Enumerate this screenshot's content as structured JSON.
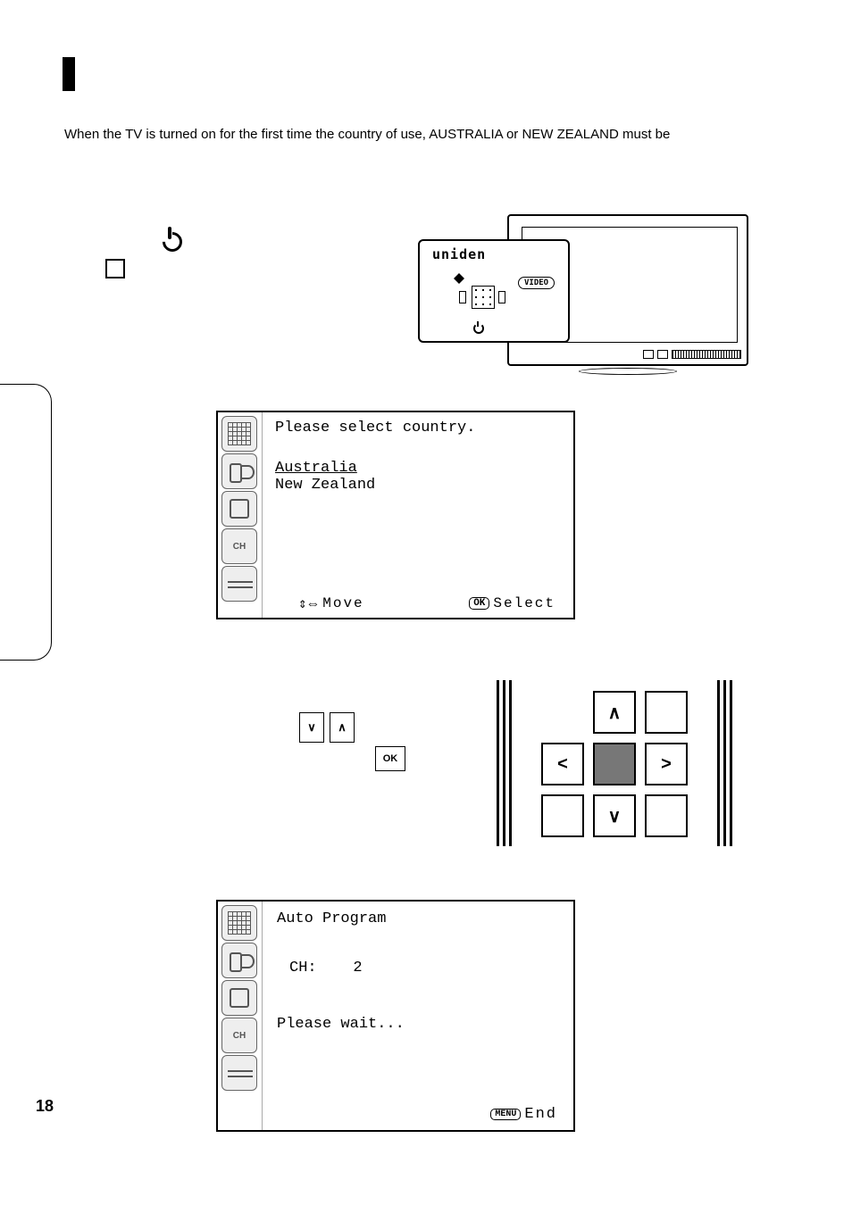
{
  "page_number": "18",
  "lead": "When the TV is turned on for the first time the country of use, AUSTRALIA or NEW ZEALAND must be",
  "callout": {
    "logo": "uniden",
    "video_label": "VIDEO"
  },
  "osd_country": {
    "title": "Please select country.",
    "options": [
      "Australia",
      "New Zealand"
    ],
    "selected_index": 0,
    "footer_move": "Move",
    "footer_select": "Select",
    "footer_ok_chip": "OK"
  },
  "keypad": {
    "up": "∧",
    "down": "∨",
    "left": "<",
    "right": ">"
  },
  "step2": {
    "btn_down": "∨",
    "btn_up": "∧",
    "ok_label": "OK"
  },
  "osd_autoprogram": {
    "title": "Auto Program",
    "ch_label": "CH:",
    "ch_value": "2",
    "wait": "Please wait...",
    "end_chip": "MENU",
    "end_label": "End"
  }
}
